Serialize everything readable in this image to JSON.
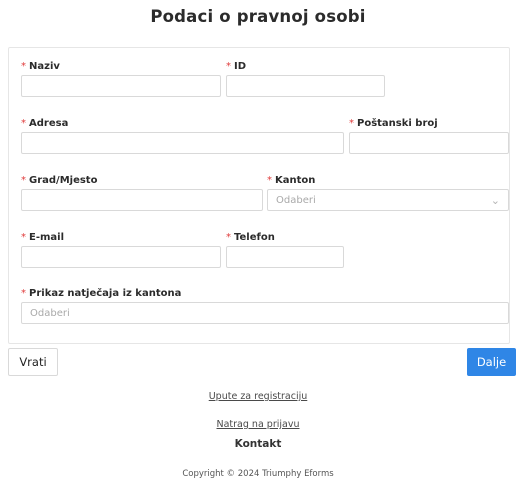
{
  "page": {
    "title": "Podaci o pravnoj osobi"
  },
  "form": {
    "naziv": {
      "label": "Naziv",
      "value": ""
    },
    "id": {
      "label": "ID",
      "value": ""
    },
    "adresa": {
      "label": "Adresa",
      "value": ""
    },
    "postanski_broj": {
      "label": "Poštanski broj",
      "value": ""
    },
    "grad": {
      "label": "Grad/Mjesto",
      "value": ""
    },
    "kanton": {
      "label": "Kanton",
      "placeholder": "Odaberi"
    },
    "email": {
      "label": "E-mail",
      "value": ""
    },
    "telefon": {
      "label": "Telefon",
      "value": ""
    },
    "prikaz": {
      "label": "Prikaz natječaja iz kantona",
      "placeholder": "Odaberi"
    },
    "required_mark": "*"
  },
  "actions": {
    "back_label": "Vrati",
    "next_label": "Dalje"
  },
  "footer": {
    "link_registration": "Upute za registraciju",
    "link_login": "Natrag na prijavu",
    "contact": "Kontakt",
    "copyright": "Copyright © 2024 Triumphy Eforms"
  },
  "colors": {
    "accent": "#2f86e6",
    "required": "#e03b3b"
  },
  "icons": {
    "select_chevron": "chevron-down-icon"
  }
}
